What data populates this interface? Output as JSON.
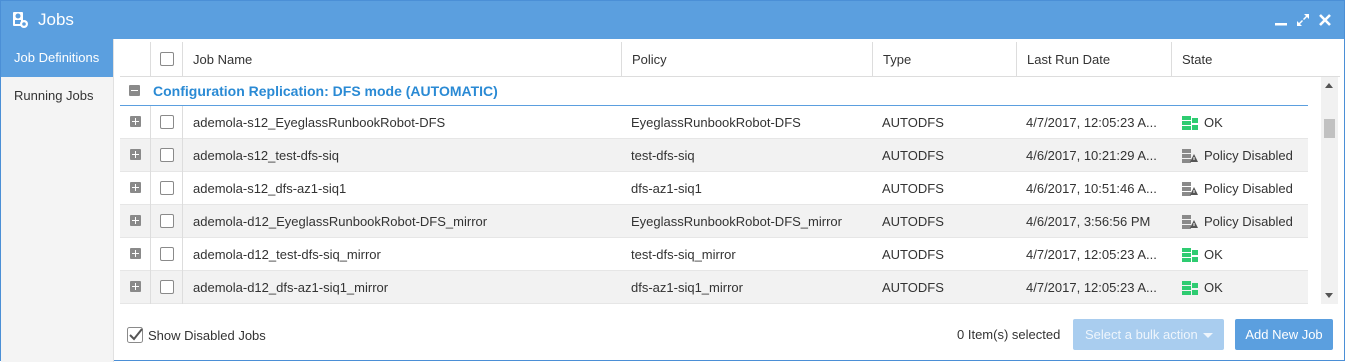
{
  "window": {
    "title": "Jobs"
  },
  "sidebar": {
    "items": [
      {
        "label": "Job Definitions"
      },
      {
        "label": "Running Jobs"
      }
    ]
  },
  "table": {
    "columns": {
      "job_name": "Job Name",
      "policy": "Policy",
      "type": "Type",
      "last_run": "Last Run Date",
      "state": "State"
    },
    "group_label": "Configuration Replication: DFS mode (AUTOMATIC)",
    "rows": [
      {
        "job_name": "ademola-s12_EyeglassRunbookRobot-DFS",
        "policy": "EyeglassRunbookRobot-DFS",
        "type": "AUTODFS",
        "last_run": "4/7/2017, 12:05:23 A...",
        "state": "OK",
        "state_icon": "ok-icon"
      },
      {
        "job_name": "ademola-s12_test-dfs-siq",
        "policy": "test-dfs-siq",
        "type": "AUTODFS",
        "last_run": "4/6/2017, 10:21:29 A...",
        "state": "Policy Disabled",
        "state_icon": "policy-disabled-icon"
      },
      {
        "job_name": "ademola-s12_dfs-az1-siq1",
        "policy": "dfs-az1-siq1",
        "type": "AUTODFS",
        "last_run": "4/6/2017, 10:51:46 A...",
        "state": "Policy Disabled",
        "state_icon": "policy-disabled-icon"
      },
      {
        "job_name": "ademola-d12_EyeglassRunbookRobot-DFS_mirror",
        "policy": "EyeglassRunbookRobot-DFS_mirror",
        "type": "AUTODFS",
        "last_run": "4/6/2017, 3:56:56 PM",
        "state": "Policy Disabled",
        "state_icon": "policy-disabled-icon"
      },
      {
        "job_name": "ademola-d12_test-dfs-siq_mirror",
        "policy": "test-dfs-siq_mirror",
        "type": "AUTODFS",
        "last_run": "4/7/2017, 12:05:23 A...",
        "state": "OK",
        "state_icon": "ok-icon"
      },
      {
        "job_name": "ademola-d12_dfs-az1-siq1_mirror",
        "policy": "dfs-az1-siq1_mirror",
        "type": "AUTODFS",
        "last_run": "4/7/2017, 12:05:23 A...",
        "state": "OK",
        "state_icon": "ok-icon"
      }
    ]
  },
  "footer": {
    "show_disabled_label": "Show Disabled Jobs",
    "selected_count": "0 Item(s) selected",
    "bulk_action_label": "Select a bulk action",
    "add_job_label": "Add New Job"
  },
  "colors": {
    "accent": "#5b9fdf",
    "group_text": "#2a8ad4",
    "ok": "#2ecc71",
    "disabled": "#777777"
  }
}
